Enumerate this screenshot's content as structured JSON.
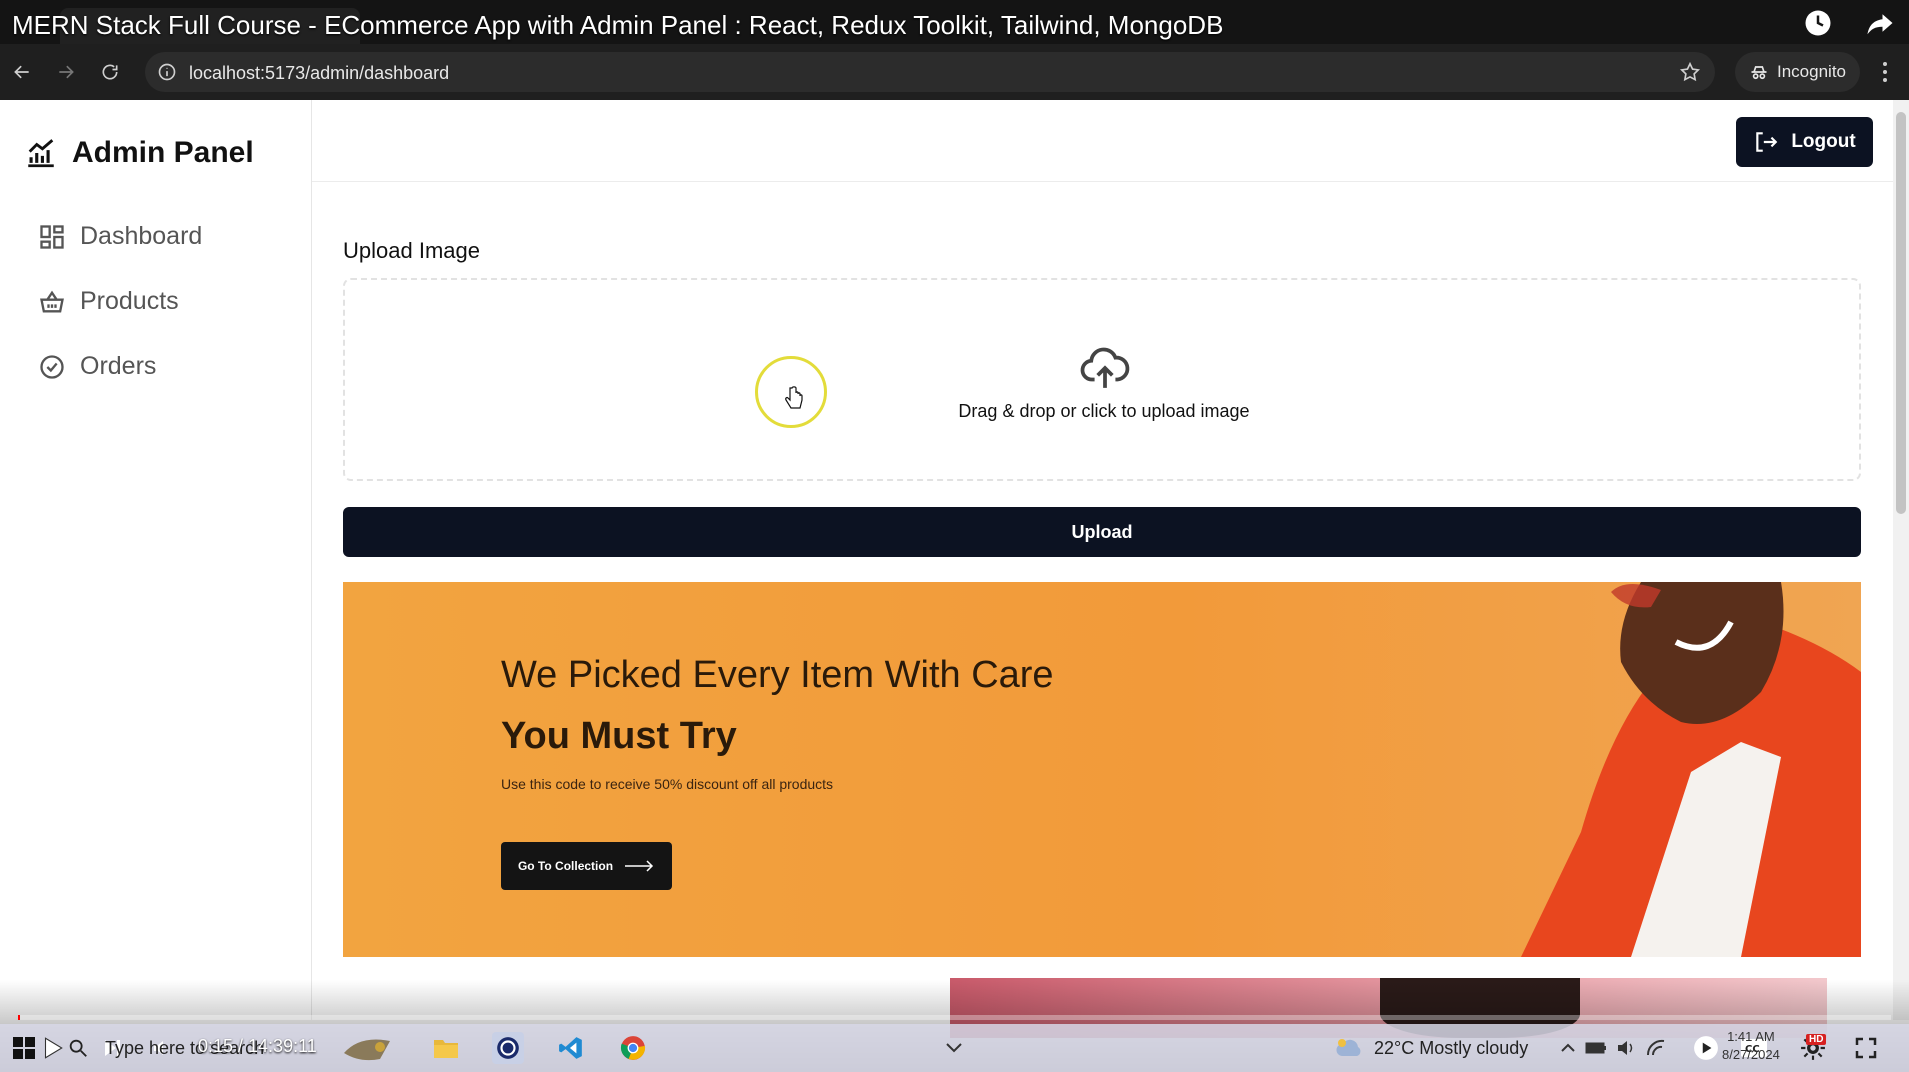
{
  "video": {
    "title": "MERN Stack Full Course - ECommerce App with Admin Panel : React, Redux Toolkit, Tailwind, MongoDB",
    "time": "0:15 / 14:39:11",
    "progress": 0.0003
  },
  "browser": {
    "url": "localhost:5173/admin/dashboard",
    "incognito_label": "Incognito"
  },
  "sidebar": {
    "brand": "Admin Panel",
    "items": [
      {
        "label": "Dashboard",
        "icon": "dashboard-grid-icon"
      },
      {
        "label": "Products",
        "icon": "basket-icon"
      },
      {
        "label": "Orders",
        "icon": "badge-check-icon"
      }
    ]
  },
  "header": {
    "logout_label": "Logout"
  },
  "upload": {
    "title": "Upload Image",
    "drop_text": "Drag & drop or click to upload image",
    "button_label": "Upload"
  },
  "banner": {
    "headline": "We Picked Every Item With Care",
    "subheadline": "You Must Try",
    "caption": "Use this code to receive 50% discount off all products",
    "button_label": "Go To Collection",
    "colors": {
      "background": "#f29a3a",
      "jacket": "#e8461e"
    }
  },
  "taskbar": {
    "search_placeholder": "Type here to search",
    "weather": "22°C  Mostly cloudy",
    "time": "1:41 AM",
    "date": "8/27/2024"
  },
  "colors": {
    "primary_dark": "#0c1222",
    "accent_progress": "#ff0000",
    "cursor_highlight": "#e3dc3a"
  }
}
